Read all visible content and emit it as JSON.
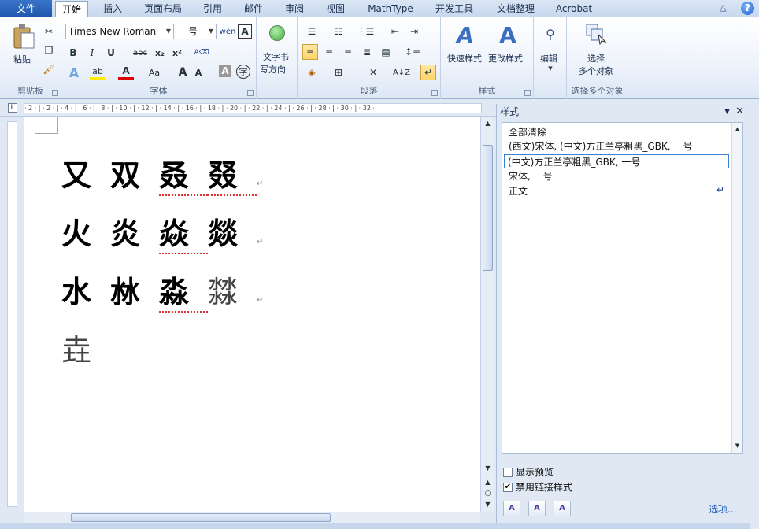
{
  "tabs": {
    "file": "文件",
    "items": [
      "开始",
      "插入",
      "页面布局",
      "引用",
      "邮件",
      "审阅",
      "视图",
      "MathType",
      "开发工具",
      "文档整理",
      "Acrobat"
    ]
  },
  "ribbon": {
    "clipboard": {
      "paste": "粘贴",
      "group": "剪贴板"
    },
    "font": {
      "name": "Times New Roman",
      "size": "一号",
      "group": "字体",
      "bold": "B",
      "italic": "I",
      "underline": "U",
      "strike": "abc",
      "sub": "x₂",
      "sup": "x²",
      "grow": "A",
      "shrink": "A",
      "case": "Aa"
    },
    "textdir": {
      "line1": "文字书",
      "line2": "写方向"
    },
    "paragraph": {
      "group": "段落"
    },
    "styles": {
      "quick": "快速样式",
      "change": "更改样式",
      "group": "样式"
    },
    "edit": {
      "label": "编辑"
    },
    "select": {
      "line1": "选择",
      "line2": "多个对象",
      "group": "选择多个对象"
    }
  },
  "ruler": {
    "ticks": "· 2 · | · 2 · | · 4 · | · 6 · | · 8 · | · 10 · | · 12 · | · 14 · | · 16 · | · 18 · | · 20 · | · 22 · | · 24 · | · 26 · | · 28 · | · 30 · | · 32 ·"
  },
  "document": {
    "lines": [
      [
        "又",
        "双",
        "叒",
        "叕"
      ],
      [
        "火",
        "炎",
        "焱",
        "燚"
      ],
      [
        "水",
        "沝",
        "淼",
        "㵘"
      ],
      [
        "垚"
      ]
    ]
  },
  "styles_pane": {
    "title": "样式",
    "items": [
      "全部清除",
      "(西文)宋体, (中文)方正兰亭粗黑_GBK, 一号",
      "(中文)方正兰亭粗黑_GBK, 一号",
      "宋体, 一号",
      "正文"
    ],
    "show_preview": "显示预览",
    "disable_linked": "禁用链接样式",
    "options": "选项..."
  }
}
